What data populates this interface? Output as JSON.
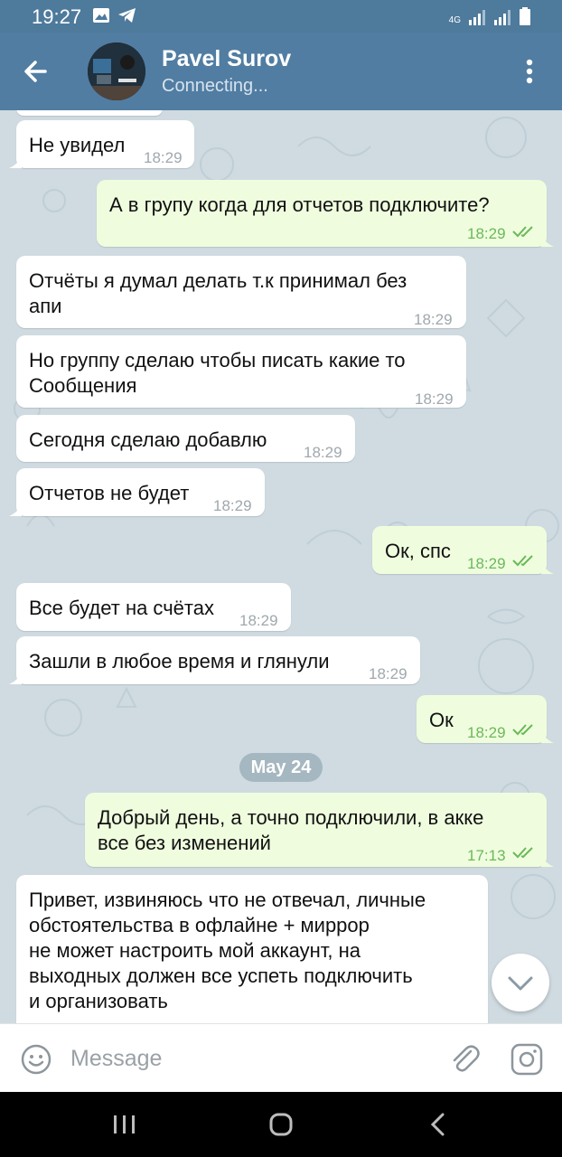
{
  "status_bar": {
    "time": "19:27",
    "network": "4G"
  },
  "header": {
    "name": "Pavel Surov",
    "status": "Connecting..."
  },
  "messages": [
    {
      "dir": "in",
      "text": "Не увидел",
      "time": "18:29"
    },
    {
      "dir": "out",
      "text": "А в групу когда для отчетов подключите?",
      "time": "18:29"
    },
    {
      "dir": "in",
      "text": "Отчёты я думал делать т.к принимал без\nапи",
      "time": "18:29"
    },
    {
      "dir": "in",
      "text": "Но группу сделаю чтобы писать какие то\nСообщения",
      "time": "18:29"
    },
    {
      "dir": "in",
      "text": "Сегодня сделаю добавлю",
      "time": "18:29"
    },
    {
      "dir": "in",
      "text": "Отчетов не будет",
      "time": "18:29"
    },
    {
      "dir": "out",
      "text": "Ок, спс",
      "time": "18:29"
    },
    {
      "dir": "in",
      "text": "Все будет на счётах",
      "time": "18:29"
    },
    {
      "dir": "in",
      "text": "Зашли в любое время и глянули",
      "time": "18:29"
    },
    {
      "dir": "out",
      "text": "Ок",
      "time": "18:29"
    },
    {
      "dir": "out",
      "text": "Добрый день, а точно подключили, в акке\nвсе без изменений",
      "time": "17:13"
    },
    {
      "dir": "in",
      "text": "Привет, извиняюсь что не отвечал, личные\nобстоятельства в офлайне + миррор\nне может настроить мой аккаунт, на\nвыходных должен все успеть подключить\nи организовать",
      "time": ""
    }
  ],
  "date_separator": "May 24",
  "composer": {
    "placeholder": "Message"
  },
  "colors": {
    "header": "#517da2",
    "outgoing_bubble": "#effdde",
    "incoming_bubble": "#ffffff",
    "check": "#6cb85a"
  }
}
